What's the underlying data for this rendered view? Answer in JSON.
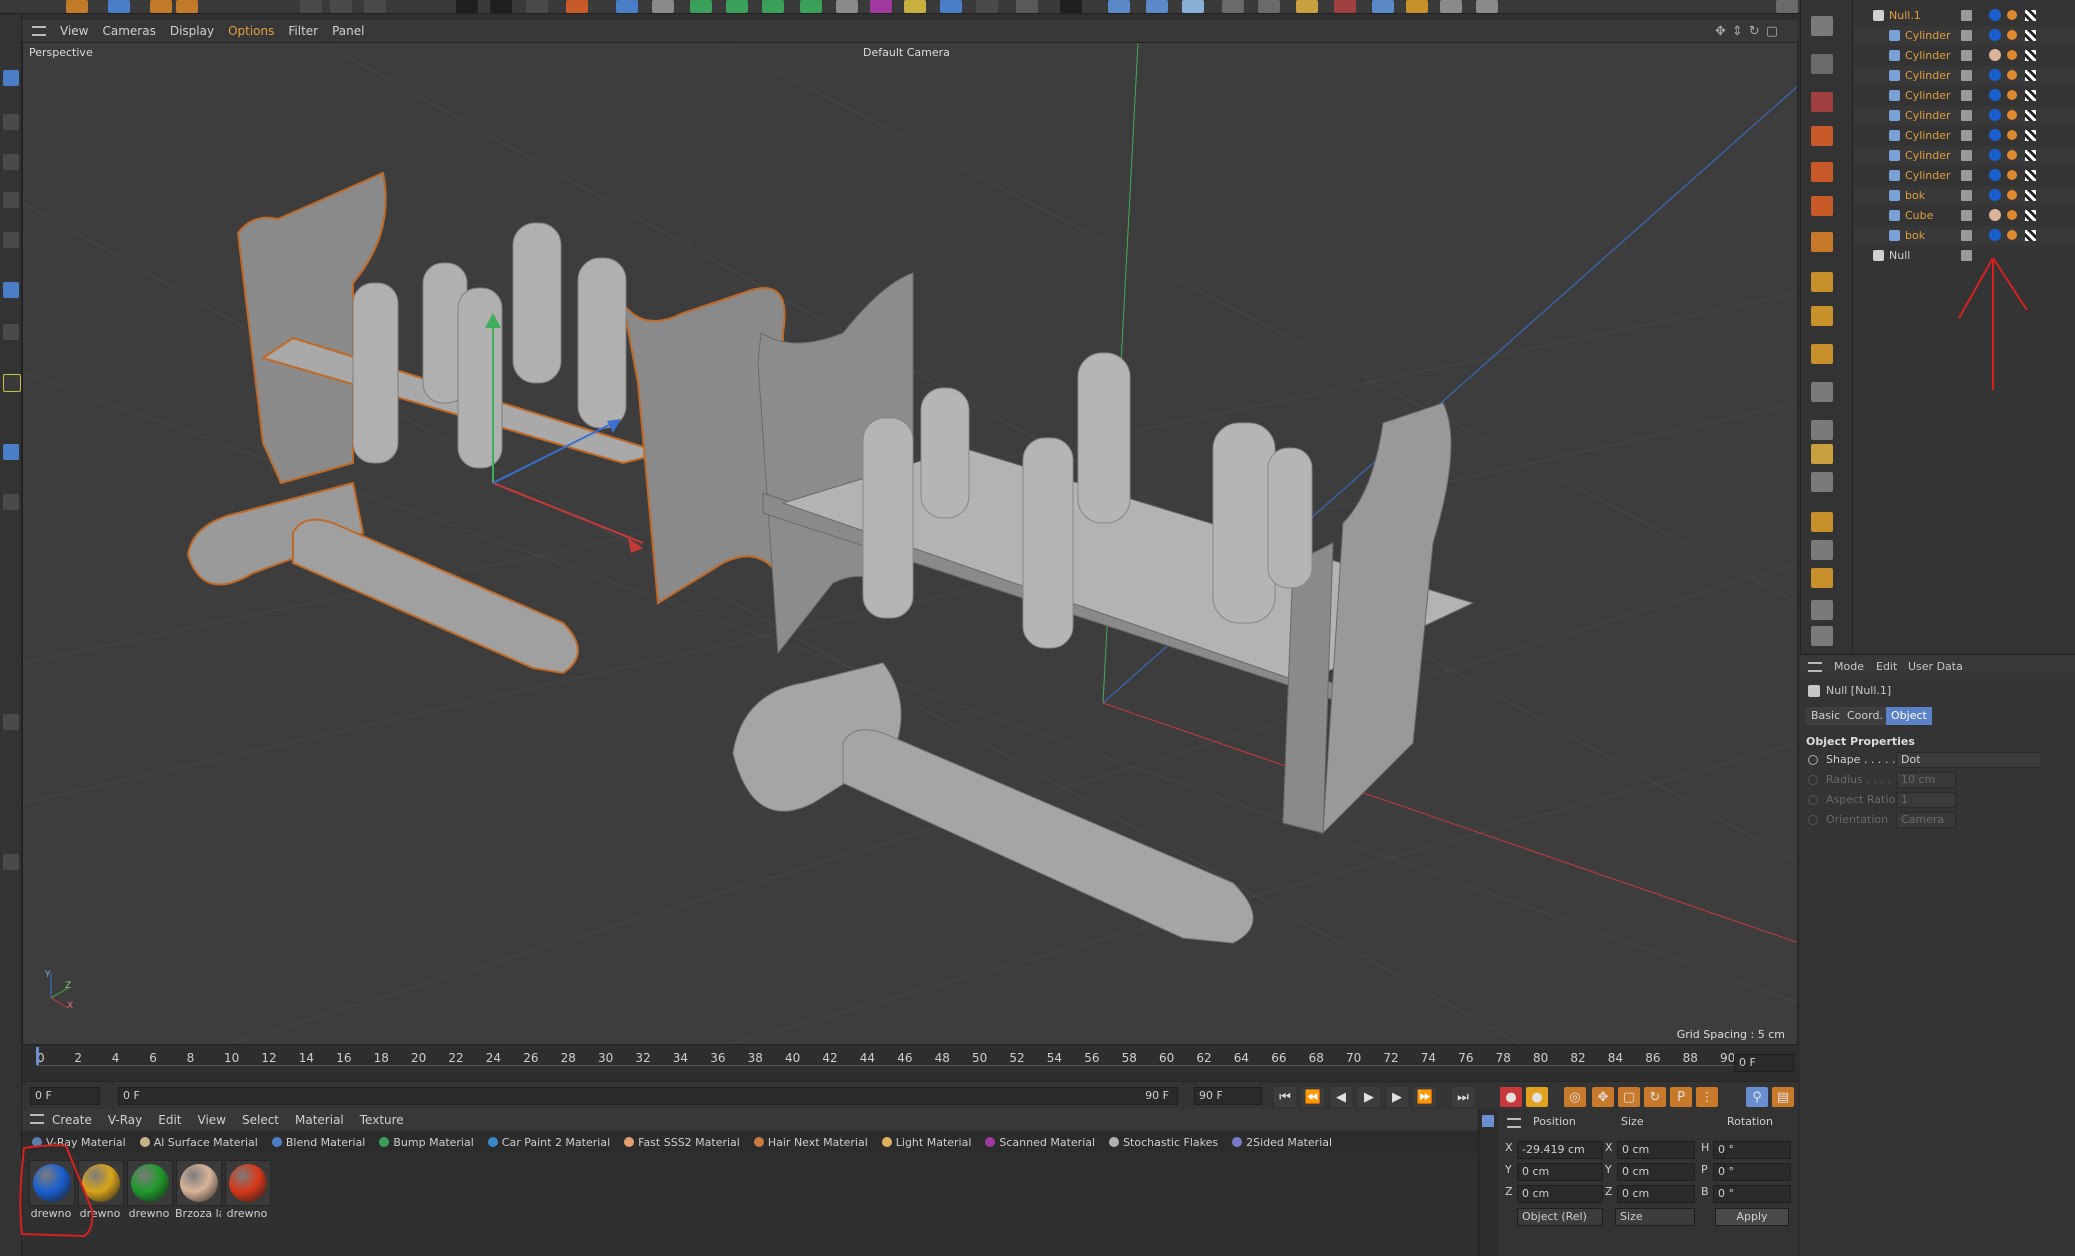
{
  "viewport_menu": [
    "View",
    "Cameras",
    "Display",
    "Options",
    "Filter",
    "Panel"
  ],
  "viewport": {
    "view_name": "Perspective",
    "camera_name": "Default Camera",
    "grid_spacing": "Grid Spacing : 5 cm",
    "axis_y": "Y",
    "axis_z": "Z",
    "axis_x": "X"
  },
  "timeline": {
    "ticks": [
      "0",
      "2",
      "4",
      "6",
      "8",
      "10",
      "12",
      "14",
      "16",
      "18",
      "20",
      "22",
      "24",
      "26",
      "28",
      "30",
      "32",
      "34",
      "36",
      "38",
      "40",
      "42",
      "44",
      "46",
      "48",
      "50",
      "52",
      "54",
      "56",
      "58",
      "60",
      "62",
      "64",
      "66",
      "68",
      "70",
      "72",
      "74",
      "76",
      "78",
      "80",
      "82",
      "84",
      "86",
      "88",
      "90"
    ],
    "end_frame_field": "0 F",
    "current_frame": "0 F",
    "range_start": "0 F",
    "range_end": "90 F",
    "max_frame": "90 F"
  },
  "material_menu": [
    "Create",
    "V-Ray",
    "Edit",
    "View",
    "Select",
    "Material",
    "Texture"
  ],
  "material_tabs": [
    {
      "label": "V-Ray Material",
      "color": "#5a7fa8"
    },
    {
      "label": "Al Surface Material",
      "color": "#c8b28a"
    },
    {
      "label": "Blend Material",
      "color": "#4a7fc8"
    },
    {
      "label": "Bump Material",
      "color": "#3aa05a"
    },
    {
      "label": "Car Paint 2 Material",
      "color": "#3a88c8"
    },
    {
      "label": "Fast SSS2 Material",
      "color": "#e0a070"
    },
    {
      "label": "Hair Next Material",
      "color": "#c87a40"
    },
    {
      "label": "Light Material",
      "color": "#e0b060"
    },
    {
      "label": "Scanned Material",
      "color": "#a03aa0"
    },
    {
      "label": "Stochastic Flakes",
      "color": "#b0b0b0"
    },
    {
      "label": "2Sided Material",
      "color": "#7a7ac8"
    }
  ],
  "materials": [
    {
      "name": "drewno",
      "color": "#1a5fd0"
    },
    {
      "name": "drewno",
      "color": "#d8a418"
    },
    {
      "name": "drewno",
      "color": "#1f9a2a"
    },
    {
      "name": "Brzoza la",
      "color": "#d9b49a"
    },
    {
      "name": "drewno",
      "color": "#d83818"
    }
  ],
  "coord": {
    "headers": [
      "Position",
      "Size",
      "Rotation"
    ],
    "rows": [
      {
        "axis": "X",
        "pos": "-29.419 cm",
        "size_axis": "X",
        "size": "0 cm",
        "rot_axis": "H",
        "rot": "0 °"
      },
      {
        "axis": "Y",
        "pos": "0 cm",
        "size_axis": "Y",
        "size": "0 cm",
        "rot_axis": "P",
        "rot": "0 °"
      },
      {
        "axis": "Z",
        "pos": "0 cm",
        "size_axis": "Z",
        "size": "0 cm",
        "rot_axis": "B",
        "rot": "0 °"
      }
    ],
    "mode_select": "Object (Rel)",
    "size_select": "Size",
    "apply": "Apply"
  },
  "object_manager": [
    {
      "name": "Null.1",
      "indent": 0,
      "tag": "#1a5fd0",
      "top": true
    },
    {
      "name": "Cylinder",
      "indent": 1,
      "tag": "#1a5fd0"
    },
    {
      "name": "Cylinder",
      "indent": 1,
      "tag": "#d9b49a"
    },
    {
      "name": "Cylinder",
      "indent": 1,
      "tag": "#1a5fd0"
    },
    {
      "name": "Cylinder",
      "indent": 1,
      "tag": "#1a5fd0"
    },
    {
      "name": "Cylinder",
      "indent": 1,
      "tag": "#1a5fd0"
    },
    {
      "name": "Cylinder",
      "indent": 1,
      "tag": "#1a5fd0"
    },
    {
      "name": "Cylinder",
      "indent": 1,
      "tag": "#1a5fd0"
    },
    {
      "name": "Cylinder",
      "indent": 1,
      "tag": "#1a5fd0"
    },
    {
      "name": "bok",
      "indent": 1,
      "tag": "#1a5fd0"
    },
    {
      "name": "Cube",
      "indent": 1,
      "tag": "#d9b49a"
    },
    {
      "name": "bok",
      "indent": 1,
      "tag": "#1a5fd0"
    },
    {
      "name": "Null",
      "indent": 0,
      "tag": null
    }
  ],
  "attribute_manager": {
    "menu": [
      "Mode",
      "Edit",
      "User Data"
    ],
    "object_title": "Null [Null.1]",
    "tabs": [
      "Basic",
      "Coord.",
      "Object"
    ],
    "active_tab": "Object",
    "section": "Object Properties",
    "props": [
      {
        "label": "Shape . . . . .",
        "value": "Dot",
        "enabled": true
      },
      {
        "label": "Radius . . . .",
        "value": "10 cm",
        "enabled": false
      },
      {
        "label": "Aspect Ratio",
        "value": "1",
        "enabled": false
      },
      {
        "label": "Orientation",
        "value": "Camera",
        "enabled": false
      }
    ]
  }
}
